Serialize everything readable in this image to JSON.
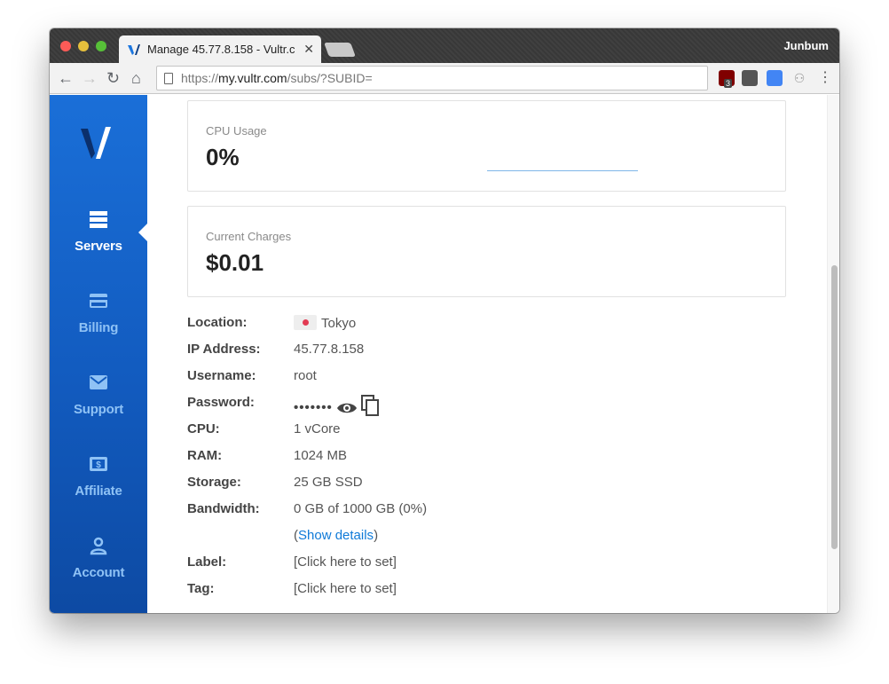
{
  "browser": {
    "tab_title": "Manage 45.77.8.158 - Vultr.c",
    "tab_close": "✕",
    "profile_name": "Junbum",
    "url_scheme": "https://",
    "url_host": "my.vultr.com",
    "url_path": "/subs/?SUBID=",
    "extension_badge": "3",
    "icons": [
      "back-arrow-icon",
      "forward-arrow-icon",
      "reload-icon",
      "home-icon",
      "page-icon",
      "ublock-icon",
      "bulb-icon",
      "translate-icon",
      "network-icon",
      "menu-dots-icon"
    ]
  },
  "sidebar": {
    "items": [
      {
        "label": "Servers",
        "icon": "servers-icon",
        "active": true
      },
      {
        "label": "Billing",
        "icon": "billing-card-icon"
      },
      {
        "label": "Support",
        "icon": "envelope-icon"
      },
      {
        "label": "Affiliate",
        "icon": "dollar-bill-icon"
      },
      {
        "label": "Account",
        "icon": "user-icon"
      }
    ]
  },
  "cards": {
    "cpu": {
      "label": "CPU Usage",
      "value": "0%"
    },
    "charges": {
      "label": "Current Charges",
      "value": "$0.01"
    }
  },
  "details": {
    "location": {
      "key": "Location:",
      "value": "Tokyo"
    },
    "ip": {
      "key": "IP Address:",
      "value": "45.77.8.158"
    },
    "username": {
      "key": "Username:",
      "value": "root"
    },
    "password": {
      "key": "Password:",
      "value": "•••••••"
    },
    "cpu": {
      "key": "CPU:",
      "value": "1 vCore"
    },
    "ram": {
      "key": "RAM:",
      "value": "1024 MB"
    },
    "storage": {
      "key": "Storage:",
      "value": "25 GB SSD"
    },
    "bandwidth": {
      "key": "Bandwidth:",
      "value": "0 GB of 1000 GB (0%)"
    },
    "show_details": {
      "open": "(",
      "link": "Show details",
      "close": ")"
    },
    "label": {
      "key": "Label:",
      "value": "[Click here to set]"
    },
    "tag": {
      "key": "Tag:",
      "value": "[Click here to set]"
    }
  },
  "colors": {
    "sidebar_top": "#1a6fd8",
    "sidebar_bottom": "#0d4aa3",
    "link": "#0f7ad8"
  }
}
